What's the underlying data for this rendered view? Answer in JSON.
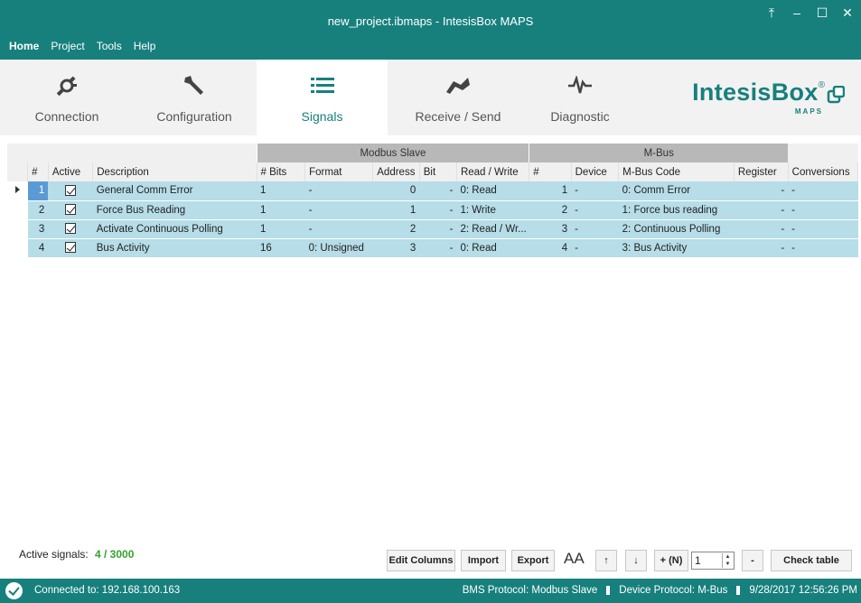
{
  "window": {
    "title": "new_project.ibmaps - IntesisBox MAPS",
    "controls": {
      "upload": "⤒",
      "minimize": "–",
      "maximize": "☐",
      "close": "✕"
    }
  },
  "menu": {
    "items": [
      "Home",
      "Project",
      "Tools",
      "Help"
    ]
  },
  "ribbon": {
    "tabs": [
      "Connection",
      "Configuration",
      "Signals",
      "Receive / Send",
      "Diagnostic"
    ],
    "selected": "Signals",
    "brand": "IntesisBox",
    "brand_sub": "MAPS",
    "brand_reg": "®"
  },
  "grid": {
    "groups": {
      "modbus": "Modbus Slave",
      "mbus": "M-Bus"
    },
    "columns": [
      "#",
      "Active",
      "Description",
      "# Bits",
      "Format",
      "Address",
      "Bit",
      "Read / Write",
      "#",
      "Device",
      "M-Bus Code",
      "Register",
      "Conversions"
    ],
    "rows": [
      {
        "num": "1",
        "desc": "General Comm Error",
        "bits": "1",
        "format": "-",
        "address": "0",
        "bit": "-",
        "rw": "0: Read",
        "mnum": "1",
        "device": "-",
        "code": "0: Comm Error",
        "register": "-",
        "conv": "-"
      },
      {
        "num": "2",
        "desc": "Force Bus Reading",
        "bits": "1",
        "format": "-",
        "address": "1",
        "bit": "-",
        "rw": "1: Write",
        "mnum": "2",
        "device": "-",
        "code": "1: Force bus reading",
        "register": "-",
        "conv": "-"
      },
      {
        "num": "3",
        "desc": "Activate Continuous Polling",
        "bits": "1",
        "format": "-",
        "address": "2",
        "bit": "-",
        "rw": "2: Read / Wr...",
        "mnum": "3",
        "device": "-",
        "code": "2: Continuous Polling",
        "register": "-",
        "conv": "-"
      },
      {
        "num": "4",
        "desc": "Bus Activity",
        "bits": "16",
        "format": "0: Unsigned",
        "address": "3",
        "bit": "-",
        "rw": "0: Read",
        "mnum": "4",
        "device": "-",
        "code": "3: Bus Activity",
        "register": "-",
        "conv": "-"
      }
    ]
  },
  "footer": {
    "active_label": "Active signals:",
    "active_value": "4 / 3000",
    "buttons": {
      "edit_columns": "Edit Columns",
      "import": "Import",
      "export": "Export",
      "up": "↑",
      "down": "↓",
      "add_n": "+ (N)",
      "minus": "-",
      "check_table": "Check table"
    },
    "font_size_label": "AA",
    "add_count": "1"
  },
  "status": {
    "connected": "Connected to:  192.168.100.163",
    "bms_protocol": "BMS Protocol: Modbus Slave",
    "device_protocol": "Device Protocol: M-Bus",
    "datetime": "9/28/2017 12:56:26 PM"
  },
  "colors": {
    "teal": "#17807d",
    "row": "#b6dde8",
    "active_green": "#35a02c"
  }
}
